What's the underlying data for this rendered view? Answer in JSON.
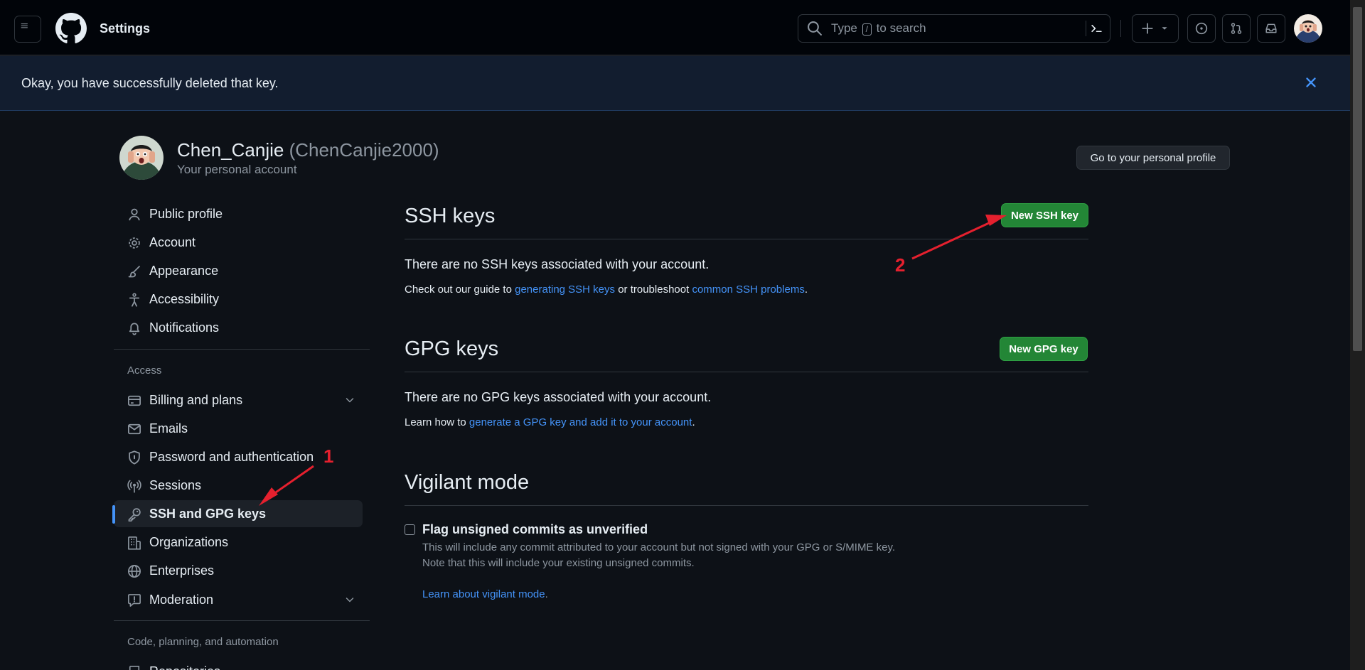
{
  "header": {
    "title": "Settings",
    "search_placeholder_pre": "Type",
    "search_placeholder_key": "/",
    "search_placeholder_post": "to search"
  },
  "flash": {
    "message": "Okay, you have successfully deleted that key."
  },
  "profile": {
    "display_name": "Chen_Canjie",
    "login": "(ChenCanjie2000)",
    "subtitle": "Your personal account",
    "profile_button": "Go to your personal profile"
  },
  "sidebar": {
    "items_top": [
      {
        "label": "Public profile",
        "icon": "person-icon"
      },
      {
        "label": "Account",
        "icon": "gear-icon"
      },
      {
        "label": "Appearance",
        "icon": "paintbrush-icon"
      },
      {
        "label": "Accessibility",
        "icon": "accessibility-icon"
      },
      {
        "label": "Notifications",
        "icon": "bell-icon"
      }
    ],
    "access_label": "Access",
    "items_access": [
      {
        "label": "Billing and plans",
        "icon": "credit-card-icon"
      },
      {
        "label": "Emails",
        "icon": "mail-icon"
      },
      {
        "label": "Password and authentication",
        "icon": "shield-lock-icon"
      },
      {
        "label": "Sessions",
        "icon": "broadcast-icon"
      },
      {
        "label": "SSH and GPG keys",
        "icon": "key-icon"
      },
      {
        "label": "Organizations",
        "icon": "organization-icon"
      },
      {
        "label": "Enterprises",
        "icon": "globe-icon"
      },
      {
        "label": "Moderation",
        "icon": "report-icon"
      }
    ],
    "code_label": "Code, planning, and automation",
    "items_code": [
      {
        "label": "Repositories",
        "icon": "repo-icon"
      }
    ]
  },
  "ssh": {
    "title": "SSH keys",
    "button": "New SSH key",
    "empty": "There are no SSH keys associated with your account.",
    "guide_pre": "Check out our guide to ",
    "guide_link": "generating SSH keys",
    "guide_mid": " or troubleshoot ",
    "guide_link2": "common SSH problems",
    "guide_post": "."
  },
  "gpg": {
    "title": "GPG keys",
    "button": "New GPG key",
    "empty": "There are no GPG keys associated with your account.",
    "learn_pre": "Learn how to ",
    "learn_link": "generate a GPG key and add it to your account",
    "learn_post": "."
  },
  "vigilant": {
    "title": "Vigilant mode",
    "checkbox_label": "Flag unsigned commits as unverified",
    "checked": false,
    "note1": "This will include any commit attributed to your account but not signed with your GPG or S/MIME key.",
    "note2": "Note that this will include your existing unsigned commits.",
    "learn_link": "Learn about vigilant mode",
    "learn_post": "."
  },
  "annotations": {
    "marker1": "1",
    "marker2": "2",
    "color": "#e5202e"
  },
  "colors": {
    "accent": "#4493f8",
    "green": "#238636",
    "background": "#0d1117"
  }
}
